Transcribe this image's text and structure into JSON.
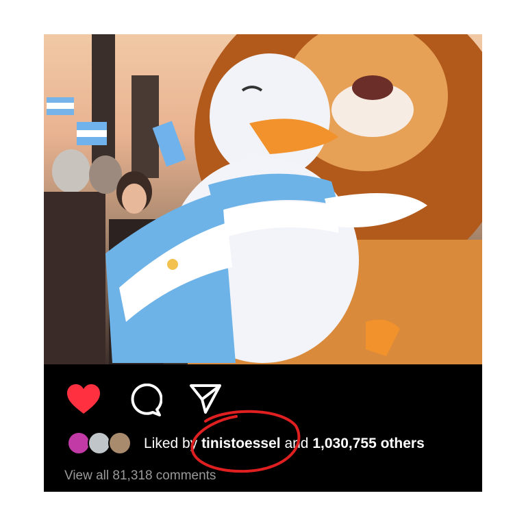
{
  "post": {
    "image_alt": "",
    "actions": {
      "like_icon": "heart-icon",
      "comment_icon": "comment-icon",
      "share_icon": "send-icon",
      "like_color": "#ff3040"
    },
    "likes": {
      "prefix": "Liked by",
      "user": "tinistoessel",
      "middle": "and",
      "count_text": "1,030,755 others"
    },
    "comments": {
      "view_all": "View all 81,318 comments"
    }
  },
  "annotation": {
    "color": "#e02020"
  }
}
